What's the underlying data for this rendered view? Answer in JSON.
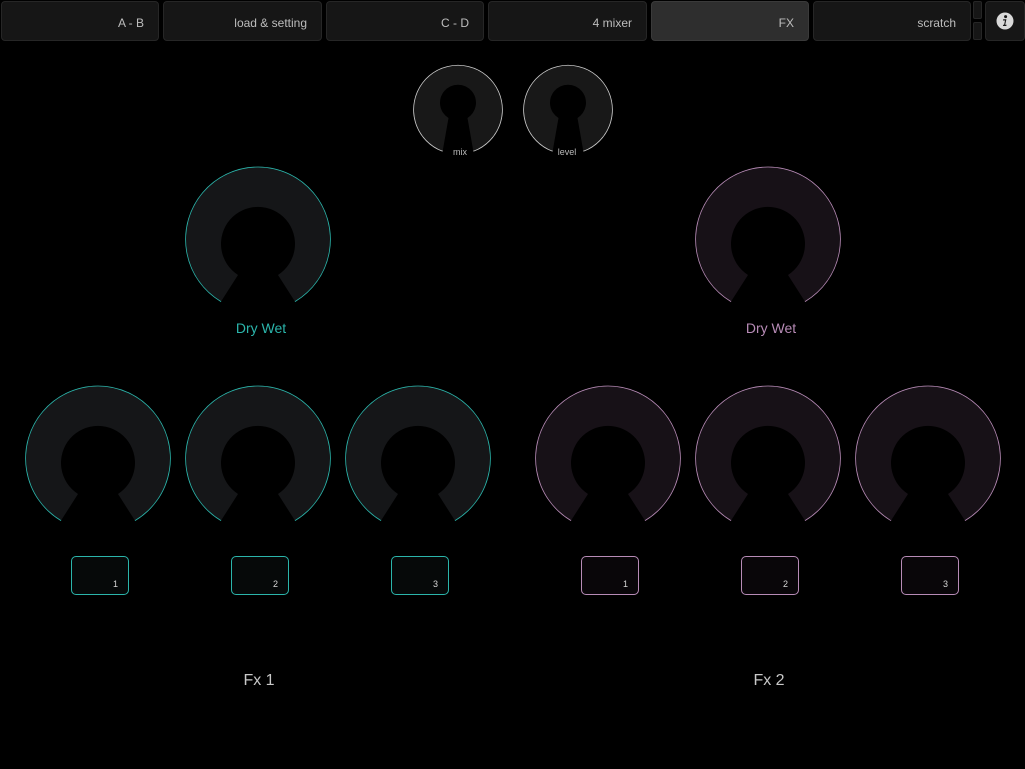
{
  "tabs": [
    {
      "id": "ab",
      "label": "A - B",
      "active": false
    },
    {
      "id": "load",
      "label": "load & setting",
      "active": false
    },
    {
      "id": "cd",
      "label": "C - D",
      "active": false
    },
    {
      "id": "mixer4",
      "label": "4 mixer",
      "active": false
    },
    {
      "id": "fx",
      "label": "FX",
      "active": true
    },
    {
      "id": "scratch",
      "label": "scratch",
      "active": false
    }
  ],
  "info_icon": "info-icon",
  "master": {
    "mix_label": "mix",
    "level_label": "level"
  },
  "fx1": {
    "title": "Fx 1",
    "drywet_label": "Dry Wet",
    "color": "#2bb5ab",
    "buttons": [
      "1",
      "2",
      "3"
    ]
  },
  "fx2": {
    "title": "Fx 2",
    "drywet_label": "Dry Wet",
    "color": "#b78bb6",
    "buttons": [
      "1",
      "2",
      "3"
    ]
  }
}
